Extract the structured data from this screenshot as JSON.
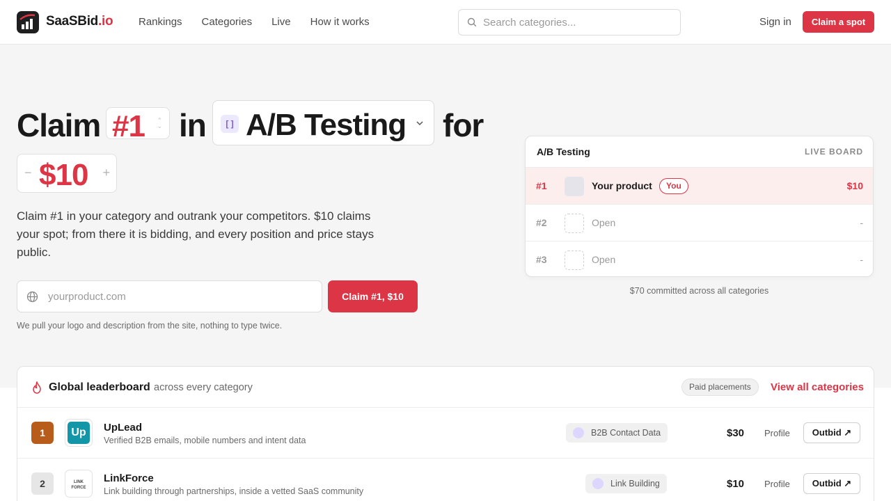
{
  "brand": {
    "name": "SaaSBid",
    "tld": ".io"
  },
  "nav": [
    "Rankings",
    "Categories",
    "Live",
    "How it works"
  ],
  "search": {
    "placeholder": "Search categories..."
  },
  "header": {
    "signin": "Sign in",
    "cta": "Claim a spot"
  },
  "hero": {
    "w1": "Claim",
    "rank": "#1",
    "w2": "in",
    "category": "A/B Testing",
    "w3": "for",
    "price": "$10",
    "description": "Claim #1 in your category and outrank your competitors. $10 claims your spot; from there it is bidding, and every position and price stays public.",
    "url_placeholder": "yourproduct.com",
    "claim_button": "Claim #1, $10",
    "note": "We pull your logo and description from the site, nothing to type twice."
  },
  "board": {
    "title": "A/B Testing",
    "live_label": "LIVE BOARD",
    "rows": [
      {
        "rank": "#1",
        "name": "Your product",
        "badge": "You",
        "price": "$10"
      },
      {
        "rank": "#2",
        "name": "Open",
        "price": "-"
      },
      {
        "rank": "#3",
        "name": "Open",
        "price": "-"
      }
    ],
    "committed": "$70 committed across all categories"
  },
  "leaderboard": {
    "title": "Global leaderboard",
    "subtitle": "across every category",
    "paid_label": "Paid placements",
    "view_all": "View all categories",
    "rows": [
      {
        "rank": "1",
        "name": "UpLead",
        "desc": "Verified B2B emails, mobile numbers and intent data",
        "category": "B2B Contact Data",
        "price": "$30",
        "profile": "Profile",
        "action": "Outbid ↗"
      },
      {
        "rank": "2",
        "name": "LinkForce",
        "desc": "Link building through partnerships, inside a vetted SaaS community",
        "category": "Link Building",
        "price": "$10",
        "profile": "Profile",
        "action": "Outbid ↗"
      }
    ]
  },
  "colors": {
    "accent": "#dc3545",
    "gold": "#b85c1b"
  }
}
